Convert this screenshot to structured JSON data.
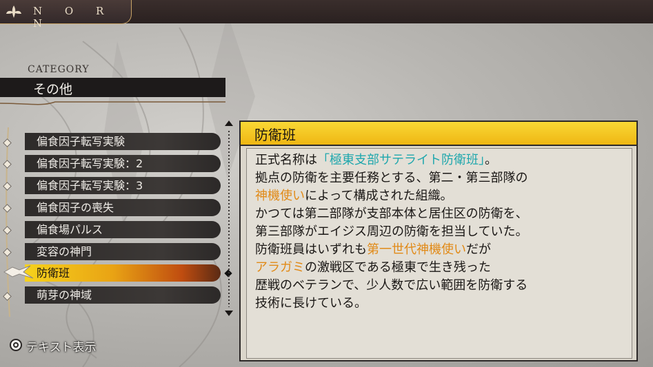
{
  "header": {
    "logo_text": "N O R N",
    "logo_icon": "leaf-crest-icon"
  },
  "category": {
    "label": "CATEGORY",
    "value": "その他"
  },
  "list": {
    "items": [
      {
        "label": "偏食因子転写実験",
        "selected": false
      },
      {
        "label": "偏食因子転写実験：2",
        "selected": false
      },
      {
        "label": "偏食因子転写実験：3",
        "selected": false
      },
      {
        "label": "偏食因子の喪失",
        "selected": false
      },
      {
        "label": "偏食場パルス",
        "selected": false
      },
      {
        "label": "変容の神門",
        "selected": false
      },
      {
        "label": "防衛班",
        "selected": true
      },
      {
        "label": "萌芽の神域",
        "selected": false
      }
    ]
  },
  "detail": {
    "title": "防衛班",
    "lines": {
      "l1a": "正式名称は",
      "l1b": "「極東支部サテライト防衛班」",
      "l1c": "。",
      "l2": "拠点の防衛を主要任務とする、第二・第三部隊の",
      "l3a": "神機使い",
      "l3b": "によって構成された組織。",
      "l4": "かつては第二部隊が支部本体と居住区の防衛を、",
      "l5": "第三部隊がエイジス周辺の防衛を担当していた。",
      "l6a": "防衛班員はいずれも",
      "l6b": "第一世代神機使い",
      "l6c": "だが",
      "l7a": "アラガミ",
      "l7b": "の激戦区である極東で生き残った",
      "l8": "歴戦のベテランで、少人数で広い範囲を防衛する",
      "l9": "技術に長けている。"
    }
  },
  "footer": {
    "button_icon": "circle-button-icon",
    "label": "テキスト表示"
  },
  "colors": {
    "highlight_cyan": "#1fa7ad",
    "highlight_orange": "#e18a17",
    "title_yellow": "#f9d835"
  }
}
